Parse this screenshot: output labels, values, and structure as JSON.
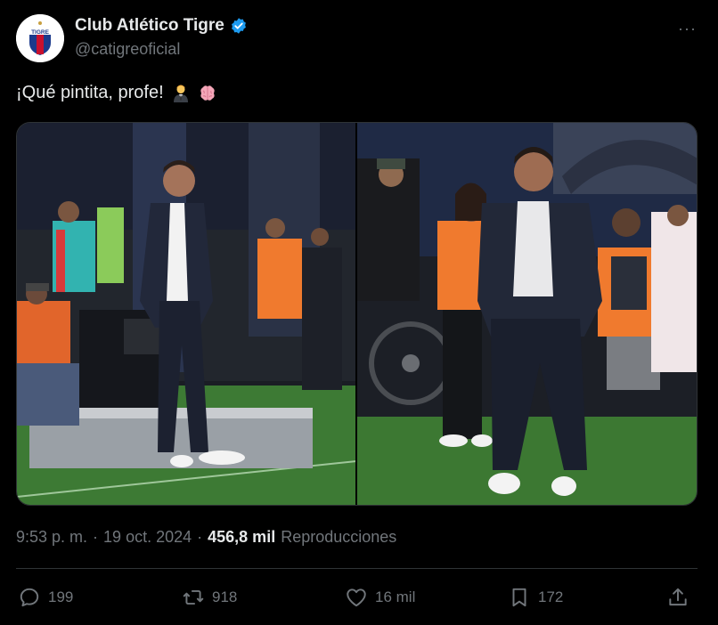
{
  "author": {
    "display_name": "Club Atlético Tigre",
    "handle": "@catigreoficial",
    "verified_icon": "verified-badge-icon",
    "avatar_text": "TIGRE",
    "colors": {
      "blue": "#1d9bf0",
      "club_red": "#c8102e",
      "club_blue": "#1b3a8c"
    }
  },
  "tweet": {
    "text": "¡Qué pintita, profe!",
    "emojis": [
      "man-office-worker-emoji",
      "brain-emoji"
    ]
  },
  "meta": {
    "time": "9:53 p. m.",
    "separator": "·",
    "date": "19 oct. 2024",
    "views_count": "456,8 mil",
    "views_label": "Reproducciones"
  },
  "actions": {
    "replies": "199",
    "retweets": "918",
    "likes": "16 mil",
    "bookmarks": "172"
  },
  "more_label": "···"
}
